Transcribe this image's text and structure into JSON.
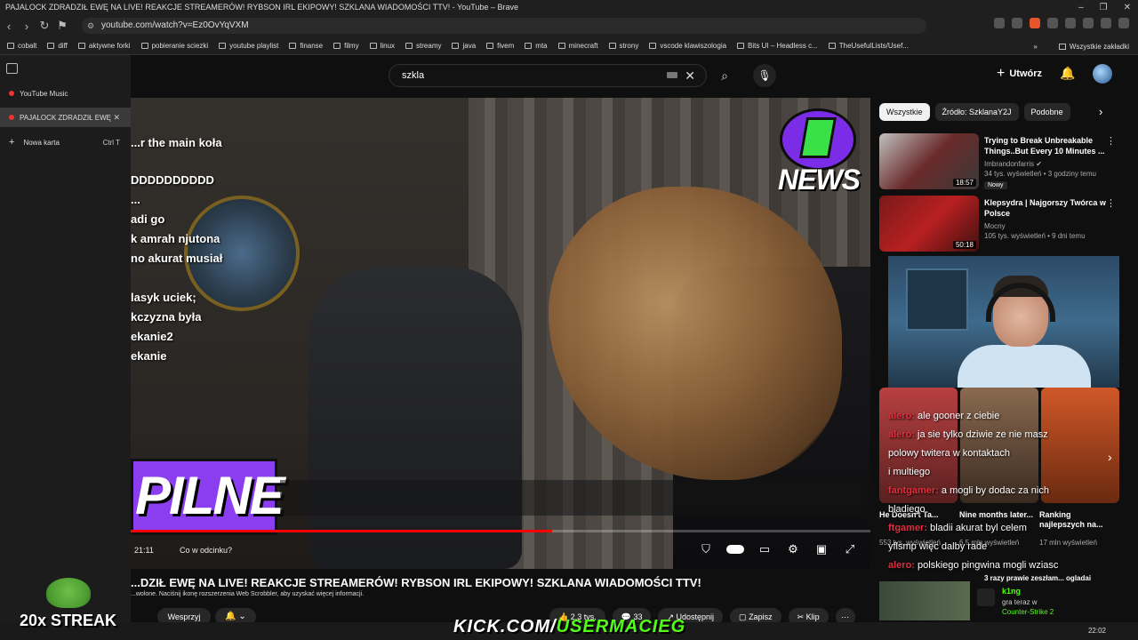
{
  "browser": {
    "window_title": "PAJALOCK ZDRADZIŁ EWĘ NA LIVE! REAKCJE STREAMERÓW! RYBSON IRL EKIPOWY! SZKLANA WIADOMOŚCI TTV! - YouTube – Brave",
    "url": "youtube.com/watch?v=Ez0OvYqVXM",
    "bookmarks": [
      "cobalt",
      "diff",
      "aktywne forki",
      "pobieranie sciezki",
      "youtube playlist",
      "finanse",
      "filmy",
      "linux",
      "streamy",
      "java",
      "fivem",
      "mta",
      "minecraft",
      "strony",
      "vscode klawiszologia",
      "Bits UI – Headless c...",
      "TheUsefulLists/Usef..."
    ],
    "bookmarks_more": "»",
    "all_bookmarks": "Wszystkie zakładki"
  },
  "vtabs": {
    "items": [
      {
        "label": "YouTube Music"
      },
      {
        "label": "PAJALOCK ZDRADZIŁ EWĘ"
      }
    ],
    "new_tab": "Nowa karta",
    "new_tab_kbd": "Ctrl   T"
  },
  "youtube": {
    "search_query": "szkla",
    "create_label": "Utwórz"
  },
  "video": {
    "chat_lines": [
      "...r the main koła",
      "DDDDDDDDDD",
      "...",
      "adi go",
      "k amrah njutona",
      "no akurat musiał",
      "",
      "lasyk uciek;",
      "kczyzna była",
      "ekanie2",
      "ekanie"
    ],
    "news_logo": "NEWS",
    "pilne": "PILNE",
    "time": "21:11",
    "chapter": "Co w odcinku?",
    "progress": 0.57,
    "title": "...DZIŁ EWĘ NA LIVE! REAKCJE STREAMERÓW! RYBSON IRL EKIPOWY! SZKLANA WIADOMOŚCI TTV!",
    "note": "...wolone. Naciśnij ikonę rozszerzenia Web Scrobbler, aby uzyskać więcej informacji.",
    "subscribe": "Wesprzyj",
    "actions": [
      {
        "label": "2,3 tys."
      },
      {
        "label": "33"
      },
      {
        "label": "Udostępnij"
      },
      {
        "label": "Zapisz"
      },
      {
        "label": "Klip"
      }
    ]
  },
  "overlays": {
    "streak": "20x STREAK",
    "kick_prefix": "KICK.COM/",
    "kick_user": "USERMACIEG"
  },
  "sidebar": {
    "chips": [
      "Wszystkie",
      "Źródło: SzklanaY2J",
      "Podobne"
    ],
    "recs": [
      {
        "title": "Trying to Break Unbreakable Things..But Every 10 Minutes ...",
        "channel": "Imbrandonfarris",
        "meta": "34 tys. wyświetleń • 3 godziny temu",
        "badge": "Nowy",
        "duration": "18:57"
      },
      {
        "title": "Klepsydra | Najgorszy Twórca w Polsce",
        "channel": "Mocny",
        "meta": "105 tys. wyświetleń • 9 dni temu",
        "badge": "",
        "duration": "50:18"
      }
    ],
    "shorts": [
      {
        "title": "He Doesn't Ta...",
        "views": "553 tys. wyświetleń"
      },
      {
        "title": "Nine months later...",
        "views": "6,5 mln wyświetleń"
      },
      {
        "title": "Ranking najlepszych na...",
        "views": "17 mln wyświetleń"
      }
    ],
    "stream_chat": [
      {
        "user": "alero:",
        "msg": "ale gooner z ciebie"
      },
      {
        "user": "alero:",
        "msg": "ja sie tylko dziwie ze nie masz"
      },
      {
        "user": "",
        "msg": "polowy twitera w kontaktach"
      },
      {
        "user": "",
        "msg": "i multiego"
      },
      {
        "user": "fantgamer:",
        "msg": "a mogli by dodac za nich"
      },
      {
        "user": "",
        "msg": "bladiego"
      },
      {
        "user": "ftgamer:",
        "msg": "bladii akurat byl celem"
      },
      {
        "user": "",
        "msg": "yflsmp więc dalby rade"
      },
      {
        "user": "alero:",
        "msg": "polskiego pingwina mogli wziasc"
      }
    ],
    "kick_card": {
      "name": "k1ng",
      "status": "gra teraz w",
      "game": "Counter-Strike 2",
      "extra": "3 razy prawie zeszłam... ogladai"
    }
  },
  "taskbar": {
    "clock": "22:02"
  },
  "colors": {
    "accent": "#ff0000",
    "kick": "#53fc18",
    "purple": "#8b3ef0"
  }
}
